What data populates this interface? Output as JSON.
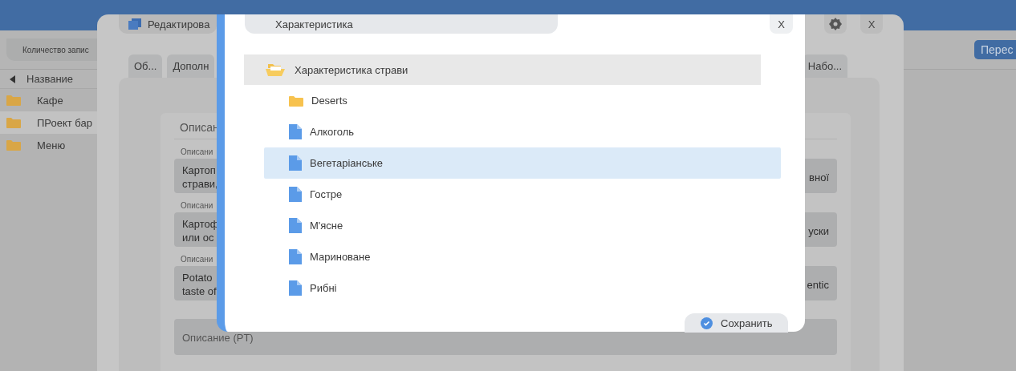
{
  "app": {
    "toolbar_label": "Количество запис",
    "action_button": "Перес",
    "list_header": "Название",
    "items": [
      {
        "label": "Кафе",
        "selected": false
      },
      {
        "label": "ПРоект бар",
        "selected": true
      },
      {
        "label": "Меню",
        "selected": false
      }
    ]
  },
  "editor": {
    "title": "Редактирова",
    "close": "X",
    "tabs": [
      {
        "label": "Об..."
      },
      {
        "label": "Дополн"
      },
      {
        "label": "Набо..."
      }
    ],
    "section_title": "Описан",
    "fields": [
      {
        "label": "Описани",
        "left_lines": [
          "Картоп",
          "страви,"
        ],
        "right_text": "вної"
      },
      {
        "label": "Описани",
        "left_lines": [
          "Картоф",
          "или ос"
        ],
        "right_text": "уски"
      },
      {
        "label": "Описани",
        "left_lines": [
          "Potato",
          "taste of"
        ],
        "right_text": "entic"
      }
    ],
    "empty_field": {
      "placeholder": "Описание (PT)"
    }
  },
  "modal": {
    "title": "Характеристика",
    "close": "X",
    "tree": {
      "label": "Характеристика страви",
      "expanded": true,
      "children": [
        {
          "label": "Deserts",
          "kind": "folder",
          "selected": false
        },
        {
          "label": "Алкоголь",
          "kind": "item",
          "selected": false
        },
        {
          "label": "Вегетаріанське",
          "kind": "item",
          "selected": true
        },
        {
          "label": "Гостре",
          "kind": "item",
          "selected": false
        },
        {
          "label": "М'ясне",
          "kind": "item",
          "selected": false
        },
        {
          "label": "Мариноване",
          "kind": "item",
          "selected": false
        },
        {
          "label": "Рибні",
          "kind": "item",
          "selected": false
        }
      ]
    },
    "save_button": "Сохранить"
  }
}
